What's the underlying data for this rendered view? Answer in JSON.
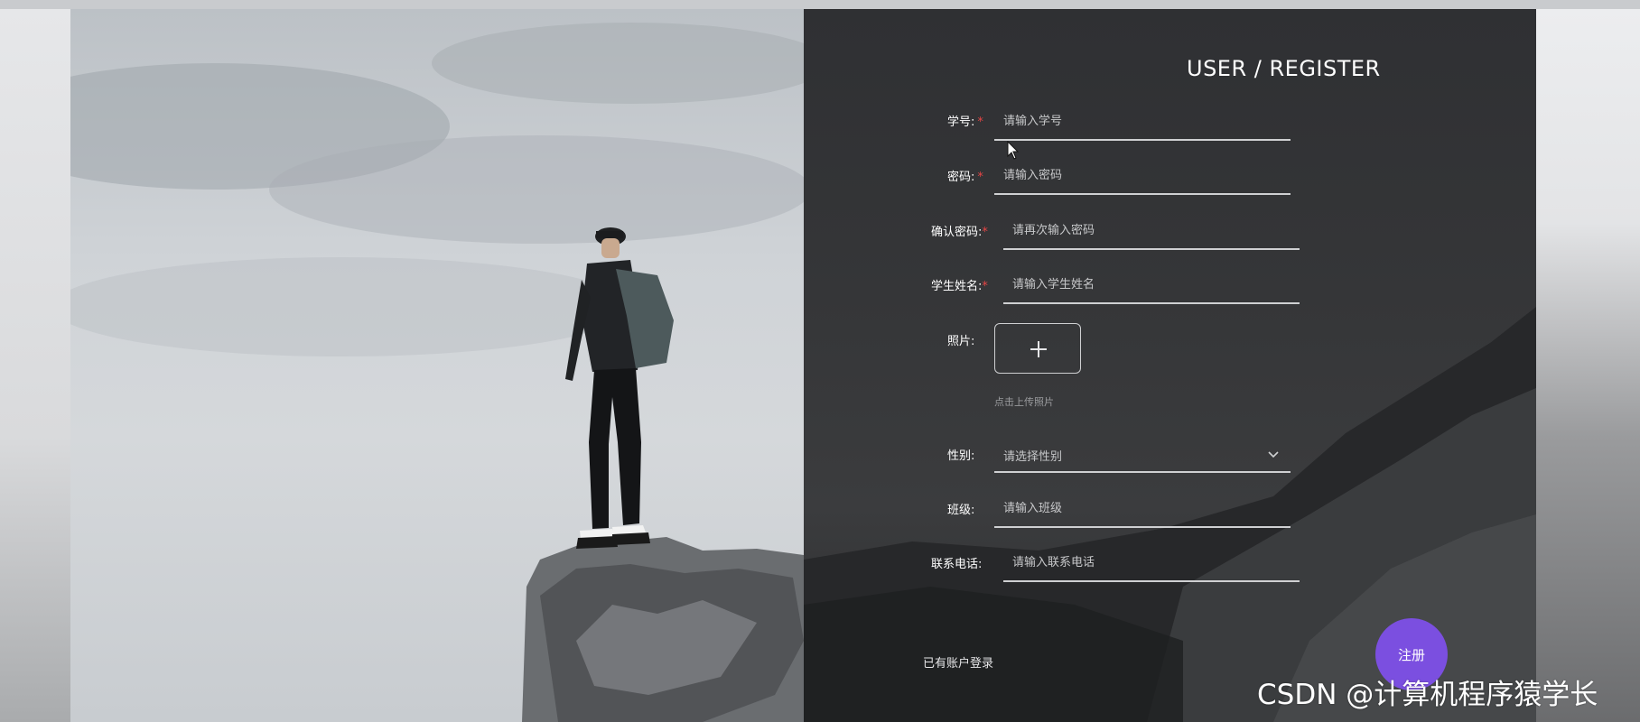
{
  "form": {
    "title": "USER / REGISTER",
    "required_mark": "*",
    "fields": {
      "student_id": {
        "label": "学号:",
        "placeholder": "请输入学号"
      },
      "password": {
        "label": "密码:",
        "placeholder": "请输入密码"
      },
      "confirm_password": {
        "label": "确认密码:",
        "placeholder": "请再次输入密码"
      },
      "student_name": {
        "label": "学生姓名:",
        "placeholder": "请输入学生姓名"
      },
      "photo": {
        "label": "照片:",
        "upload_tip": "点击上传照片"
      },
      "gender": {
        "label": "性别:",
        "selected": "请选择性别"
      },
      "class": {
        "label": "班级:",
        "placeholder": "请输入班级"
      },
      "phone": {
        "label": "联系电话:",
        "placeholder": "请输入联系电话"
      }
    },
    "login_link": "已有账户登录",
    "register_button": "注册"
  },
  "icons": {
    "upload": "plus-icon",
    "select": "chevron-down-icon",
    "cursor": "mouse-pointer-icon"
  },
  "colors": {
    "accent": "#7b4fe0",
    "required": "#e54545",
    "panel": "#333436"
  },
  "watermark": "CSDN @计算机程序猿学长"
}
